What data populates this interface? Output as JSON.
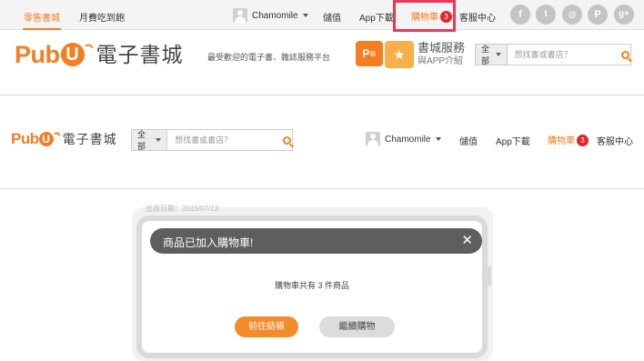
{
  "topbar": {
    "links": [
      "零售書城",
      "月費吃到飽"
    ],
    "user_name": "Chamomile",
    "nav": [
      "儲值",
      "App下載"
    ],
    "cart_label": "購物車",
    "cart_count": "3",
    "support": "客服中心",
    "social_icons": [
      "facebook-icon",
      "twitter-icon",
      "weibo-icon",
      "plurk-icon",
      "google-plus-icon"
    ]
  },
  "brand": {
    "pub": "Pub",
    "u": "U",
    "name": "電子書城",
    "tagline": "最受歡迎的電子書、雜誌服務平台",
    "app_title": "書城服務",
    "app_sub": "與APP介紹"
  },
  "search": {
    "category": "全部",
    "placeholder": "想找書或書店？"
  },
  "header2": {
    "user_name": "Chamomile",
    "nav": [
      "儲值",
      "App下載"
    ],
    "cart_label": "購物車",
    "cart_count": "3",
    "support": "客服中心"
  },
  "page": {
    "date_label": "出版日期：2015/07/13"
  },
  "modal": {
    "title": "商品已加入購物車!",
    "message": "購物車共有 3 件商品",
    "primary_button": "前往結帳",
    "secondary_button": "繼續購物"
  },
  "colors": {
    "brand_orange": "#f47e21",
    "badge_red": "#e0262a",
    "highlight_pink": "#e8395a"
  }
}
